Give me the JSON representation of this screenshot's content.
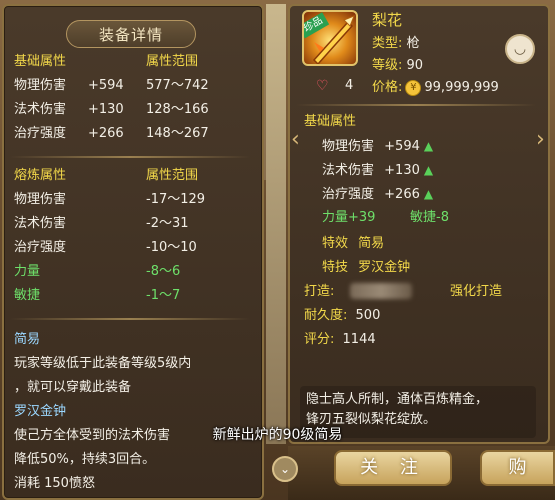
{
  "equip_panel": {
    "title": "装备详情",
    "base": {
      "header_attr": "基础属性",
      "header_range": "属性范围",
      "rows": [
        {
          "name": "物理伤害",
          "value": "+594",
          "range": "577～742"
        },
        {
          "name": "法术伤害",
          "value": "+130",
          "range": "128～166"
        },
        {
          "name": "治疗强度",
          "value": "+266",
          "range": "148～267"
        }
      ]
    },
    "forge": {
      "header_attr": "熔炼属性",
      "header_range": "属性范围",
      "rows": [
        {
          "name": "物理伤害",
          "range": "-17～129",
          "color": "white"
        },
        {
          "name": "法术伤害",
          "range": "-2～31",
          "color": "white"
        },
        {
          "name": "治疗强度",
          "range": "-10～10",
          "color": "white"
        },
        {
          "name": "力量",
          "range": "-8～6",
          "color": "green"
        },
        {
          "name": "敏捷",
          "range": "-1～7",
          "color": "green"
        }
      ]
    },
    "effect": {
      "name": "简易",
      "desc_line1": "玩家等级低于此装备等级5级内",
      "desc_line2": "，就可以穿戴此装备"
    },
    "skill": {
      "name": "罗汉金钟",
      "desc_line1": "使己方全体受到的法术伤害",
      "desc_line2": "降低50%，持续3回合。",
      "cost": "消耗 150愤怒"
    }
  },
  "item_panel": {
    "badge": "珍品",
    "name": "梨花",
    "type_label": "类型:",
    "type_value": "枪",
    "level_label": "等级:",
    "level_value": "90",
    "likes": "4",
    "price_label": "价格:",
    "price_value": "99,999,999",
    "base": {
      "header": "基础属性",
      "rows": [
        {
          "name": "物理伤害",
          "value": "+594"
        },
        {
          "name": "法术伤害",
          "value": "+130"
        },
        {
          "name": "治疗强度",
          "value": "+266"
        }
      ]
    },
    "bonus_power": "力量+39",
    "bonus_agility": "敏捷-8",
    "special_effect_label": "特效",
    "special_effect_value": "简易",
    "special_skill_label": "特技",
    "special_skill_value": "罗汉金钟",
    "forger_label": "打造:",
    "enhanced_forge": "强化打造",
    "durability_label": "耐久度:",
    "durability_value": "500",
    "score_label": "评分:",
    "score_value": "1144",
    "flavor_line1": "隐士高人所制，通体百炼精金，",
    "flavor_line2": "锋刃五裂似梨花绽放。"
  },
  "buttons": {
    "follow": "关 注",
    "buy": "购"
  },
  "subtitle": "新鲜出炉的90级简易",
  "colors": {
    "gold_text": "#f2d84a",
    "green_text": "#6ee06a",
    "skill_blue": "#9bd7ff"
  }
}
